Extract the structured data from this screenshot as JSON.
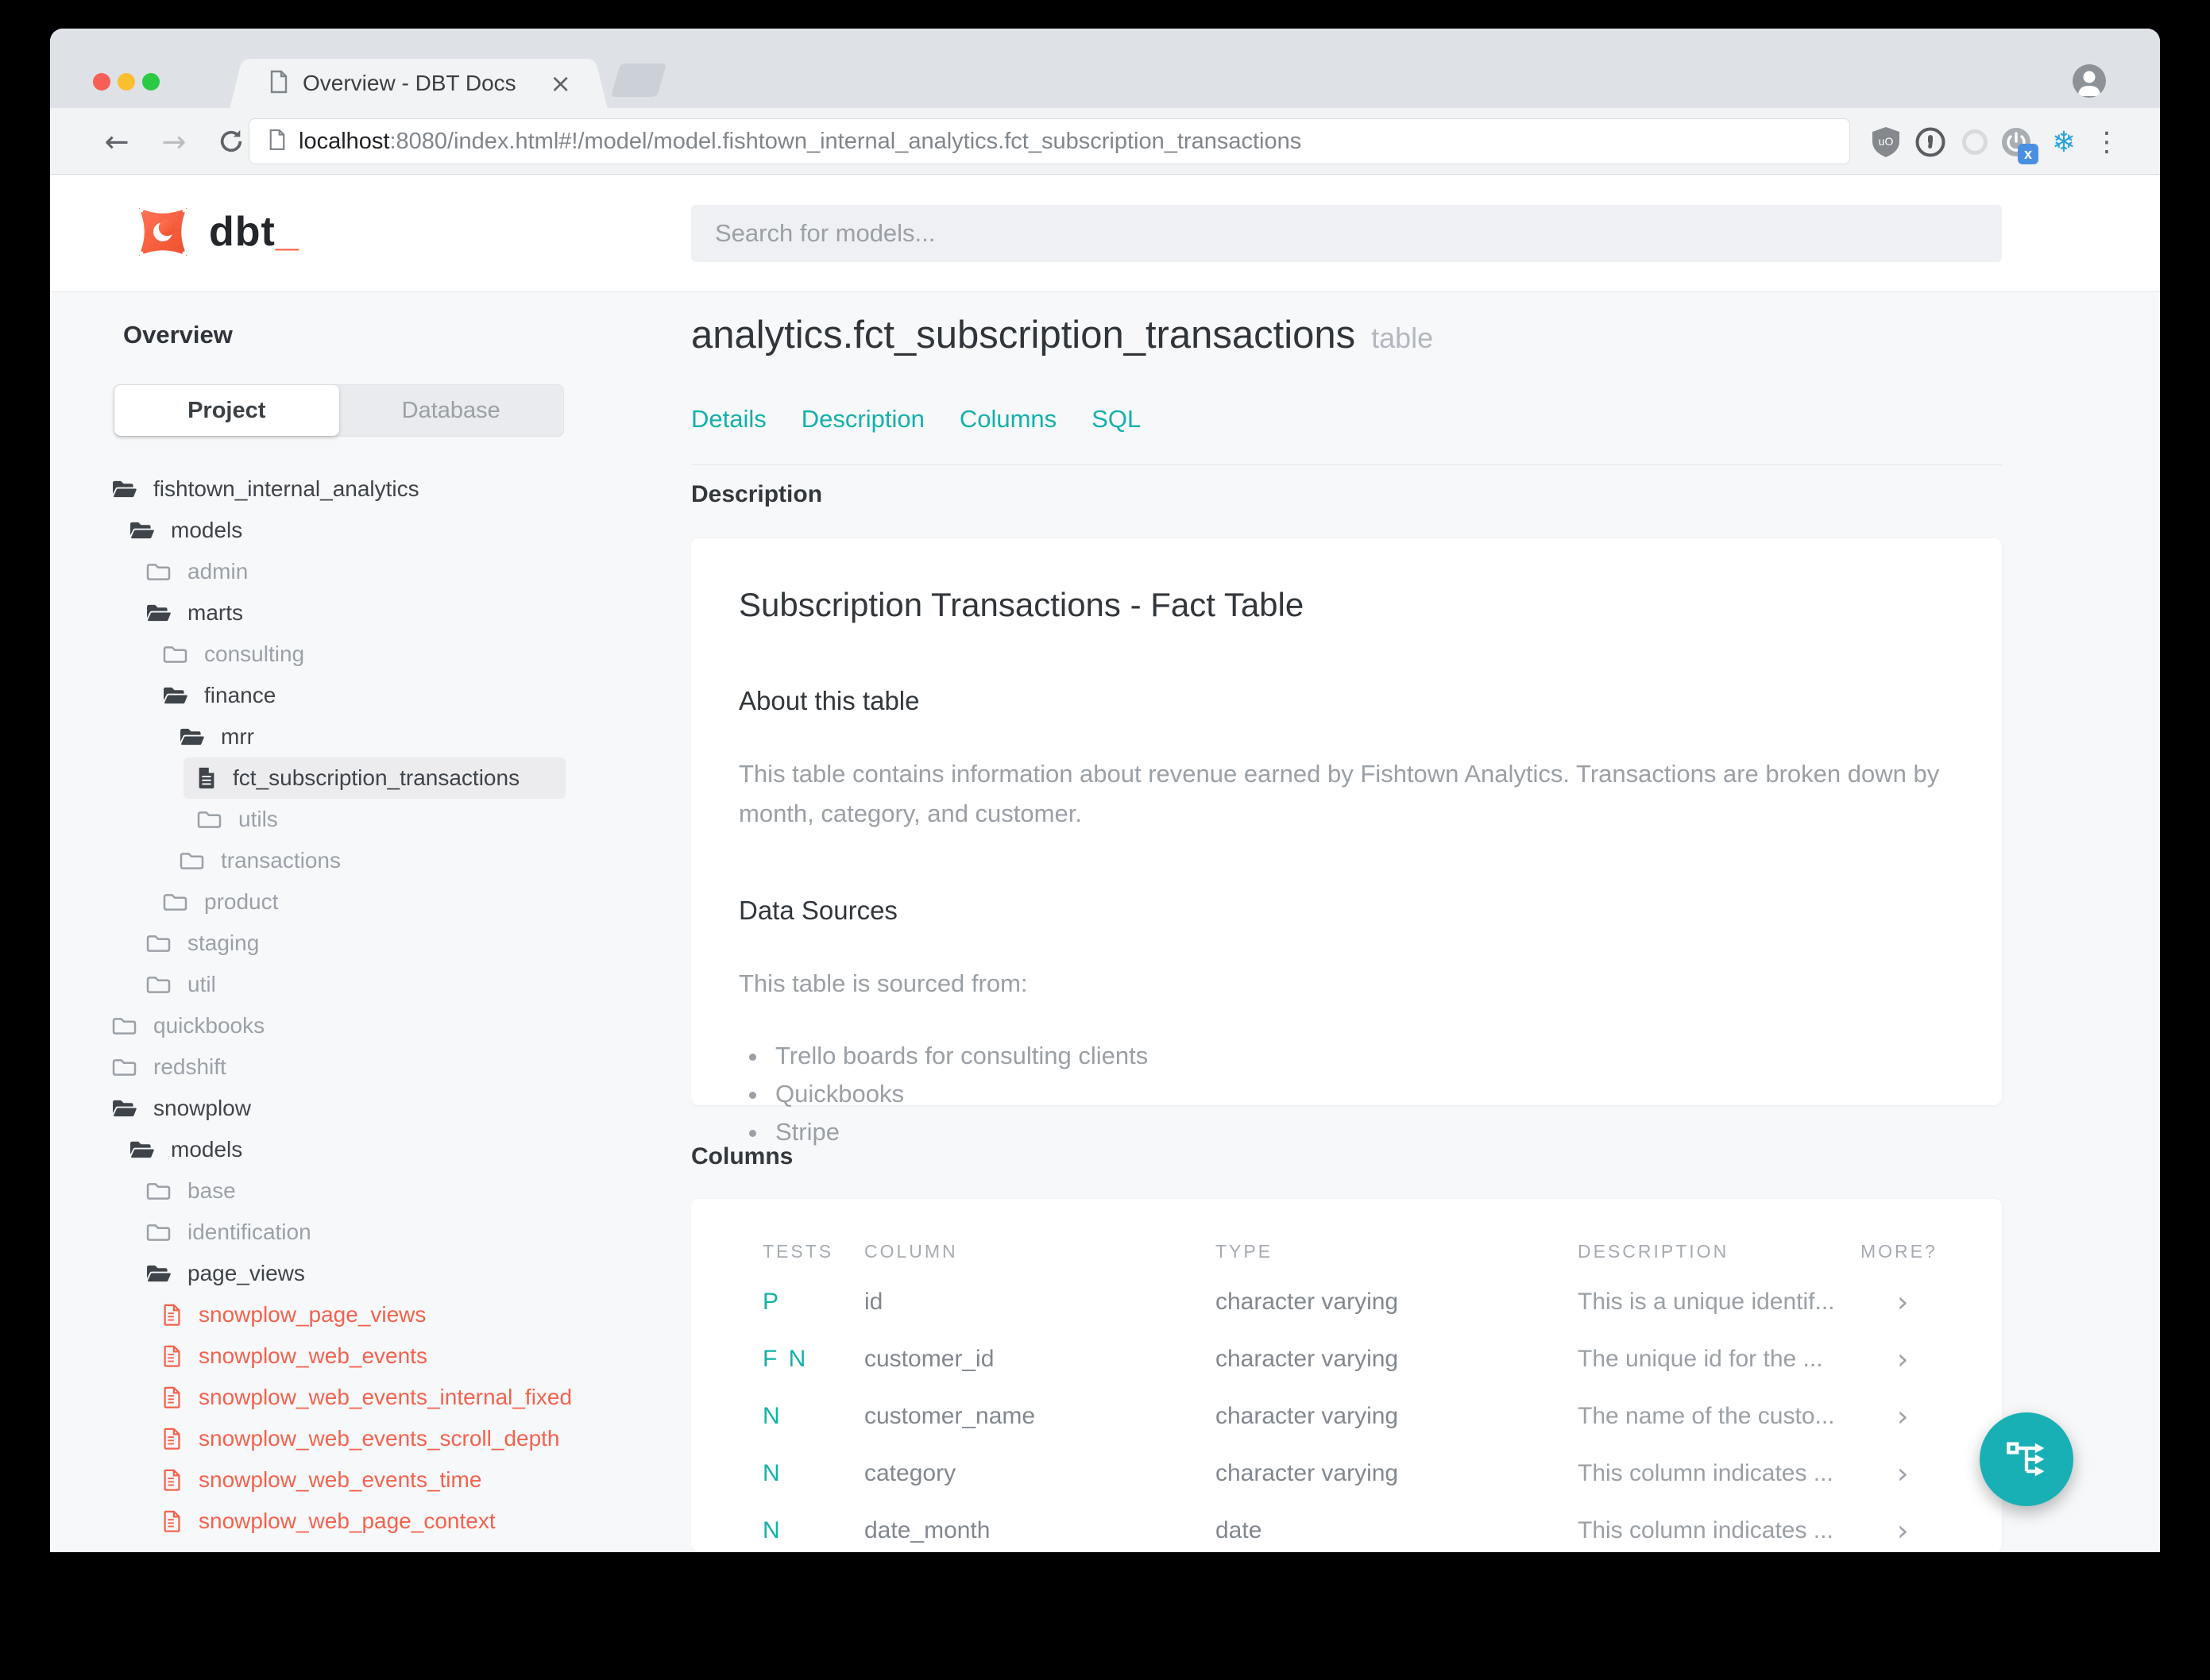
{
  "browser": {
    "window_controls": [
      "close",
      "minimize",
      "zoom"
    ],
    "tab": {
      "title": "Overview - DBT Docs",
      "close_glyph": "×"
    },
    "toolbar": {
      "back_glyph": "←",
      "forward_glyph": "→",
      "url_host": "localhost",
      "url_rest": ":8080/index.html#!/model/model.fishtown_internal_analytics.fct_subscription_transactions"
    },
    "extensions": [
      "ublock-origin",
      "onepassword",
      "pocket",
      "power-x",
      "snowflake"
    ],
    "menu_glyph": "⋮",
    "snowflake_glyph": "❄"
  },
  "app": {
    "logo_text": "dbt",
    "logo_cursor": "_",
    "search": {
      "placeholder": "Search for models..."
    }
  },
  "sidebar": {
    "title": "Overview",
    "view_tabs": [
      {
        "label": "Project",
        "active": true
      },
      {
        "label": "Database",
        "active": false
      }
    ],
    "tree": {
      "items": [
        {
          "label": "fishtown_internal_analytics",
          "depth": 1,
          "icon": "folder-open",
          "variant": "dark"
        },
        {
          "label": "models",
          "depth": 2,
          "icon": "folder-open",
          "variant": "dark"
        },
        {
          "label": "admin",
          "depth": 3,
          "icon": "folder",
          "variant": "muted"
        },
        {
          "label": "marts",
          "depth": 3,
          "icon": "folder-open",
          "variant": "dark"
        },
        {
          "label": "consulting",
          "depth": 4,
          "icon": "folder",
          "variant": "muted"
        },
        {
          "label": "finance",
          "depth": 4,
          "icon": "folder-open",
          "variant": "dark"
        },
        {
          "label": "mrr",
          "depth": 5,
          "icon": "folder-open",
          "variant": "dark"
        },
        {
          "label": "fct_subscription_transactions",
          "depth": 6,
          "icon": "file-solid",
          "variant": "dark",
          "selected": true
        },
        {
          "label": "utils",
          "depth": 6,
          "icon": "folder",
          "variant": "muted"
        },
        {
          "label": "transactions",
          "depth": 5,
          "icon": "folder",
          "variant": "muted"
        },
        {
          "label": "product",
          "depth": 4,
          "icon": "folder",
          "variant": "muted"
        },
        {
          "label": "staging",
          "depth": 3,
          "icon": "folder",
          "variant": "muted"
        },
        {
          "label": "util",
          "depth": 3,
          "icon": "folder",
          "variant": "muted"
        },
        {
          "label": "quickbooks",
          "depth": 1,
          "icon": "folder",
          "variant": "muted"
        },
        {
          "label": "redshift",
          "depth": 1,
          "icon": "folder",
          "variant": "muted"
        },
        {
          "label": "snowplow",
          "depth": 1,
          "icon": "folder-open",
          "variant": "dark"
        },
        {
          "label": "models",
          "depth": 2,
          "icon": "folder-open",
          "variant": "dark"
        },
        {
          "label": "base",
          "depth": 3,
          "icon": "folder",
          "variant": "muted"
        },
        {
          "label": "identification",
          "depth": 3,
          "icon": "folder",
          "variant": "muted"
        },
        {
          "label": "page_views",
          "depth": 3,
          "icon": "folder-open",
          "variant": "dark"
        },
        {
          "label": "snowplow_page_views",
          "depth": 4,
          "icon": "file-outline",
          "variant": "accent"
        },
        {
          "label": "snowplow_web_events",
          "depth": 4,
          "icon": "file-outline",
          "variant": "accent"
        },
        {
          "label": "snowplow_web_events_internal_fixed",
          "depth": 4,
          "icon": "file-outline",
          "variant": "accent"
        },
        {
          "label": "snowplow_web_events_scroll_depth",
          "depth": 4,
          "icon": "file-outline",
          "variant": "accent"
        },
        {
          "label": "snowplow_web_events_time",
          "depth": 4,
          "icon": "file-outline",
          "variant": "accent"
        },
        {
          "label": "snowplow_web_page_context",
          "depth": 4,
          "icon": "file-outline",
          "variant": "accent"
        }
      ]
    }
  },
  "main": {
    "title": "analytics.fct_subscription_transactions",
    "subtitle": "table",
    "nav_links": [
      "Details",
      "Description",
      "Columns",
      "SQL"
    ],
    "description_section": {
      "label": "Description",
      "heading": "Subscription Transactions - Fact Table",
      "about_heading": "About this table",
      "about_text": "This table contains information about revenue earned by Fishtown Analytics. Transactions are broken down by month, category, and customer.",
      "sources_heading": "Data Sources",
      "sources_intro": "This table is sourced from:",
      "sources": [
        "Trello boards for consulting clients",
        "Quickbooks",
        "Stripe"
      ]
    },
    "columns_section": {
      "label": "Columns",
      "headers": [
        "TESTS",
        "COLUMN",
        "TYPE",
        "DESCRIPTION",
        "MORE?"
      ],
      "rows": [
        {
          "tests": "P",
          "column": "id",
          "type": "character varying",
          "description": "This is a unique identif...",
          "more": "›"
        },
        {
          "tests": "F N",
          "column": "customer_id",
          "type": "character varying",
          "description": "The unique id for the ...",
          "more": "›"
        },
        {
          "tests": "N",
          "column": "customer_name",
          "type": "character varying",
          "description": "The name of the custo...",
          "more": "›"
        },
        {
          "tests": "N",
          "column": "category",
          "type": "character varying",
          "description": "This column indicates ...",
          "more": "›"
        },
        {
          "tests": "N",
          "column": "date_month",
          "type": "date",
          "description": "This column indicates ...",
          "more": "›"
        }
      ]
    },
    "fab_icon": "lineage-graph"
  },
  "colors": {
    "accent_teal": "#14b0ac",
    "fab_teal": "#19b0b5",
    "accent_orange": "#f4624e",
    "tabbar_gray": "#dee1e6",
    "content_gray": "#f7f8f9"
  }
}
